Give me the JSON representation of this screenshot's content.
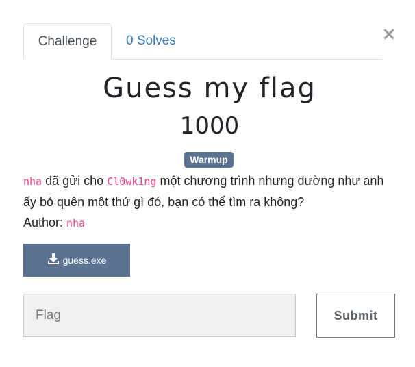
{
  "modal": {
    "close_label": "×"
  },
  "tabs": [
    {
      "label": "Challenge"
    },
    {
      "label": "0 Solves"
    }
  ],
  "challenge": {
    "name": "Guess my flag",
    "value": "1000",
    "category": "Warmup",
    "description": {
      "user1": "nha",
      "text1": " đã gửi cho ",
      "user2": "Cl0wk1ng",
      "text2": " một chương trình nhưng dường như anh ấy bỏ quên một thứ gì đó, bạn có thể tìm ra không?",
      "author_label": "Author: ",
      "author": "nha"
    },
    "file": {
      "name": "guess.exe",
      "icon": "download-icon"
    }
  },
  "form": {
    "flag_placeholder": "Flag",
    "flag_value": "",
    "submit_label": "Submit"
  },
  "colors": {
    "accent": "#5b7290",
    "link": "#337ab7",
    "code": "#e83e8c"
  }
}
